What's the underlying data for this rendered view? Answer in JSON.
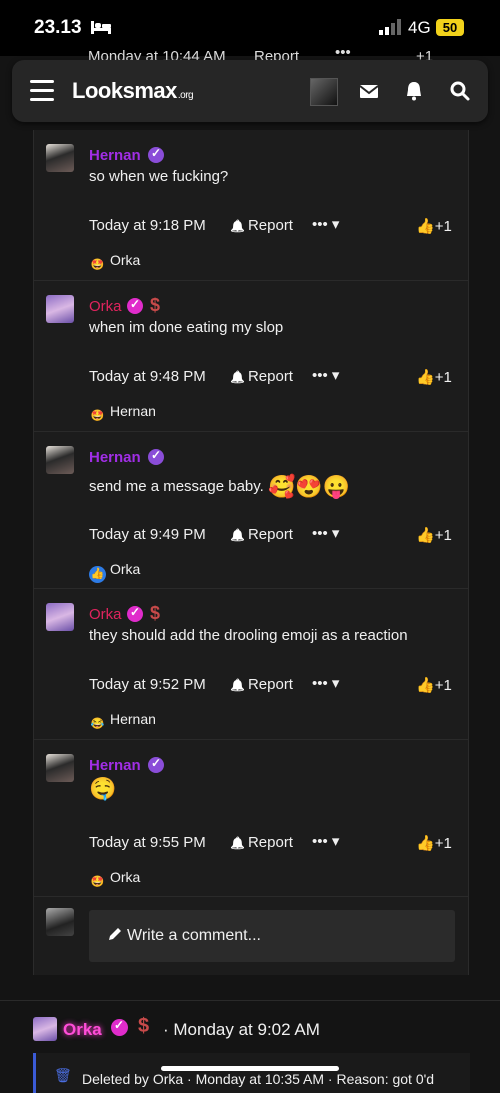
{
  "status_bar": {
    "time": "23.13",
    "network": "4G",
    "battery": "50"
  },
  "above": {
    "time": "Monday at 10:44 AM",
    "report": "Report",
    "more": "•••",
    "like": "+1"
  },
  "header": {
    "logo": "Lo",
    "logo_mid": "ks",
    "logo_end": "max",
    "logo_suffix": ".org"
  },
  "comments": [
    {
      "user": "Hernan",
      "text": "so when we fucking?",
      "time": "Today at 9:18 PM",
      "report": "Report",
      "more": "•••",
      "like": "+1",
      "reaction_user": "Orka",
      "reaction": "star-eyes"
    },
    {
      "user": "Orka",
      "text": "when im done eating my slop",
      "time": "Today at 9:48 PM",
      "report": "Report",
      "more": "•••",
      "like": "+1",
      "reaction_user": "Hernan",
      "reaction": "star-eyes"
    },
    {
      "user": "Hernan",
      "text": "send me a message baby.",
      "emojis": "🥰😍😛",
      "time": "Today at 9:49 PM",
      "report": "Report",
      "more": "•••",
      "like": "+1",
      "reaction_user": "Orka",
      "reaction": "like"
    },
    {
      "user": "Orka",
      "text": "they should add the drooling emoji as a reaction",
      "time": "Today at 9:52 PM",
      "report": "Report",
      "more": "•••",
      "like": "+1",
      "reaction_user": "Hernan",
      "reaction": "cry-laugh"
    },
    {
      "user": "Hernan",
      "text": "",
      "emojis": "🤤",
      "time": "Today at 9:55 PM",
      "report": "Report",
      "more": "•••",
      "like": "+1",
      "reaction_user": "Orka",
      "reaction": "star-eyes"
    }
  ],
  "reply": {
    "placeholder": "Write a comment..."
  },
  "next_post": {
    "user": "Orka",
    "date": "· Monday at 9:02 AM",
    "deleted_text": "Deleted by Orka · Monday at 10:35 AM · Reason: got 0'd"
  },
  "colors": {
    "hernan": "#a12ee6",
    "orka": "#e0245e",
    "verified_purple": "#8a4dd8",
    "verified_pink": "#e02ccb"
  }
}
